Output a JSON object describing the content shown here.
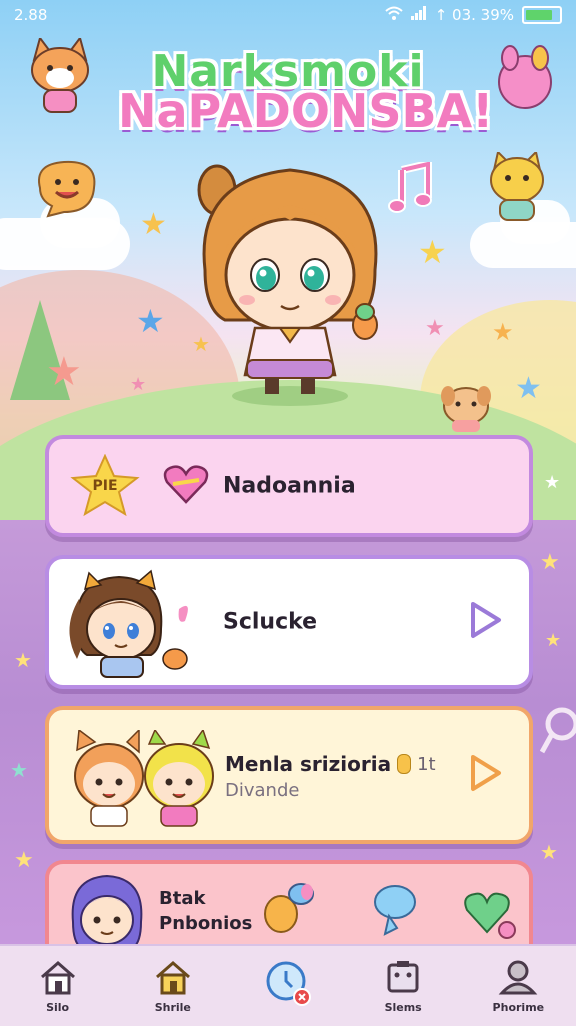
{
  "status_bar": {
    "time": "2.88",
    "right_text": "↑ 03. 39%"
  },
  "logo": {
    "line1": "Narksmoki",
    "line2": "NaPADONSBA!"
  },
  "menu": [
    {
      "badge": "PIE",
      "title": "Nadoannia"
    },
    {
      "title": "Sclucke"
    },
    {
      "title": "Menla srizioria",
      "suffix": "1t",
      "subtitle": "Divande"
    },
    {
      "title_line1": "Btak",
      "title_line2": "Pnbonios"
    }
  ],
  "nav": [
    {
      "label": "Silo",
      "icon": "home-icon"
    },
    {
      "label": "Shrile",
      "icon": "house-icon"
    },
    {
      "label": "",
      "icon": "clock-icon"
    },
    {
      "label": "Slems",
      "icon": "box-icon"
    },
    {
      "label": "Phorime",
      "icon": "profile-icon"
    }
  ],
  "colors": {
    "accent_pink": "#f27bbf",
    "accent_green": "#5fd06b",
    "card_border_purple": "#b88de4",
    "card_border_orange": "#f1a66a"
  }
}
